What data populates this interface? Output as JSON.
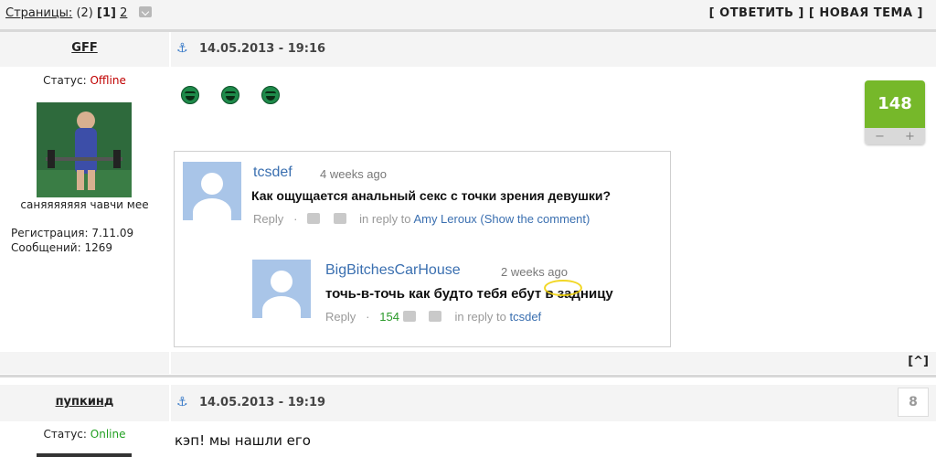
{
  "pager": {
    "label": "Страницы:",
    "count": "(2)",
    "current": "[1]",
    "next": "2"
  },
  "actions": {
    "reply": "[ ОТВЕТИТЬ ]",
    "new_topic": "[ НОВАЯ ТЕМА ]"
  },
  "posts": [
    {
      "author": "GFF",
      "status_label": "Статус:",
      "status_value": "Offline",
      "signature": "саняяяяяяя чавчи мее",
      "reg": "Регистрация: 7.11.09",
      "posts_count": "Сообщений: 1269",
      "date": "14.05.2013 - 19:16",
      "rating": "148",
      "vote_minus": "−",
      "vote_plus": "+"
    },
    {
      "author": "пупкинд",
      "status_label": "Статус:",
      "status_value": "Online",
      "date": "14.05.2013 - 19:19",
      "rating": "8",
      "message": "кэп! мы нашли его"
    }
  ],
  "embedded": {
    "c1": {
      "name": "tcsdef",
      "time": "4 weeks ago",
      "text": "Как ощущается анальный секс с точки зрения девушки?",
      "reply": "Reply",
      "in_reply": "in reply to",
      "target": "Amy Leroux (Show the comment)"
    },
    "c2": {
      "name": "BigBitchesCarHouse",
      "time": "2 weeks ago",
      "text": "точь-в-точь как будто тебя ебут в задницу",
      "reply": "Reply",
      "count": "154",
      "in_reply": "in reply to",
      "target": "tcsdef"
    }
  },
  "top_link": "[^]",
  "colors": {
    "offline": "#c00000",
    "online": "#22a022",
    "rating_bg": "#76b82a",
    "link": "#3a6fb0"
  },
  "icons": [
    "anchor-icon",
    "laughing-smiley-icon",
    "thumb-up-icon",
    "thumb-down-icon",
    "dropdown-icon"
  ]
}
